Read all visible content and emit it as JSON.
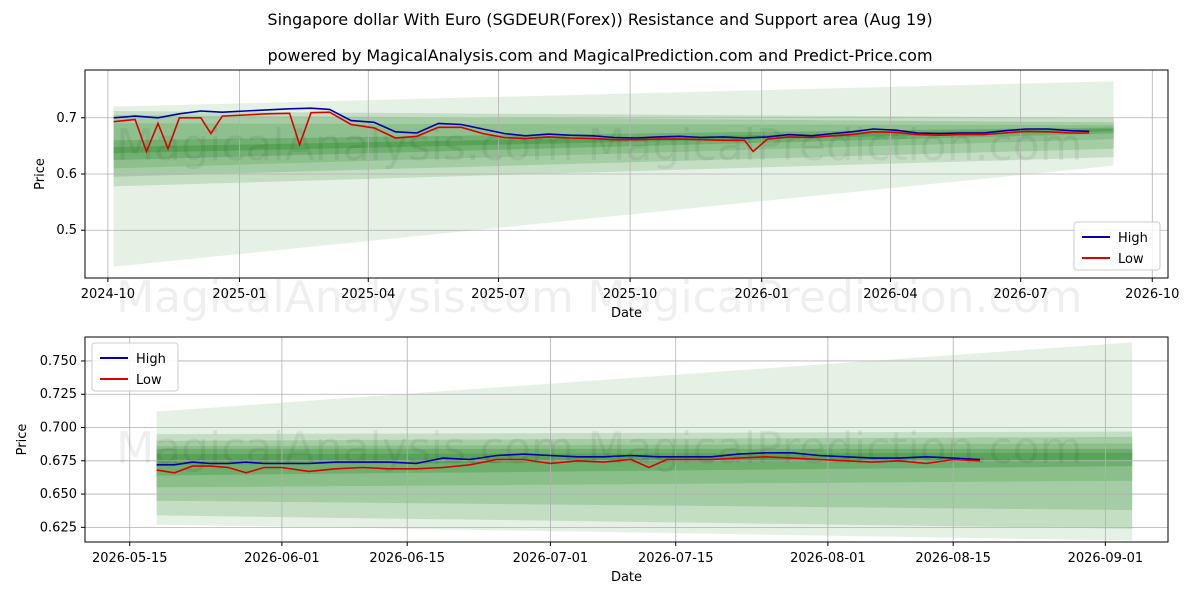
{
  "title": "Singapore dollar With Euro (SGDEUR(Forex)) Resistance and Support area (Aug 19)",
  "subtitle": "powered by MagicalAnalysis.com and MagicalPrediction.com and Predict-Price.com",
  "watermarks": [
    "MagicalAnalysis.com",
    "MagicalPrediction.com"
  ],
  "colors": {
    "high": "#0000aa",
    "low": "#dd0000",
    "band": "#2e8b2e",
    "grid": "#b0b0b0"
  },
  "chart_data": [
    {
      "type": "line",
      "title": "",
      "xlabel": "Date",
      "ylabel": "Price",
      "xlim": [
        "2024-09-15",
        "2026-10-12"
      ],
      "ylim": [
        0.415,
        0.785
      ],
      "xticks": [
        "2024-10",
        "2025-01",
        "2025-04",
        "2025-07",
        "2025-10",
        "2026-01",
        "2026-04",
        "2026-07",
        "2026-10"
      ],
      "xtick_dates": [
        "2024-10-01",
        "2025-01-01",
        "2025-04-01",
        "2025-07-01",
        "2025-10-01",
        "2026-01-01",
        "2026-04-01",
        "2026-07-01",
        "2026-10-01"
      ],
      "yticks": [
        0.5,
        0.6,
        0.7
      ],
      "grid": true,
      "legend": "lower-right",
      "series": [
        {
          "name": "High",
          "x": [
            "2024-10-05",
            "2024-10-20",
            "2024-11-05",
            "2024-11-20",
            "2024-12-05",
            "2024-12-20",
            "2025-01-05",
            "2025-01-20",
            "2025-02-05",
            "2025-02-20",
            "2025-03-05",
            "2025-03-20",
            "2025-04-05",
            "2025-04-20",
            "2025-05-05",
            "2025-05-20",
            "2025-06-05",
            "2025-06-20",
            "2025-07-05",
            "2025-07-20",
            "2025-08-05",
            "2025-08-20",
            "2025-09-05",
            "2025-09-20",
            "2025-10-05",
            "2025-10-20",
            "2025-11-05",
            "2025-11-20",
            "2025-12-05",
            "2025-12-20",
            "2026-01-05",
            "2026-01-20",
            "2026-02-05",
            "2026-02-20",
            "2026-03-05",
            "2026-03-20",
            "2026-04-05",
            "2026-04-20",
            "2026-05-05",
            "2026-05-20",
            "2026-06-05",
            "2026-06-20",
            "2026-07-05",
            "2026-07-20",
            "2026-08-05",
            "2026-08-18"
          ],
          "values": [
            0.7,
            0.703,
            0.7,
            0.707,
            0.712,
            0.71,
            0.712,
            0.714,
            0.716,
            0.717,
            0.715,
            0.695,
            0.692,
            0.675,
            0.673,
            0.69,
            0.688,
            0.68,
            0.672,
            0.668,
            0.671,
            0.669,
            0.668,
            0.665,
            0.664,
            0.666,
            0.667,
            0.665,
            0.666,
            0.664,
            0.666,
            0.67,
            0.668,
            0.672,
            0.675,
            0.68,
            0.678,
            0.673,
            0.672,
            0.673,
            0.673,
            0.677,
            0.68,
            0.68,
            0.677,
            0.676
          ]
        },
        {
          "name": "Low",
          "x": [
            "2024-10-05",
            "2024-10-20",
            "2024-10-28",
            "2024-11-05",
            "2024-11-12",
            "2024-11-20",
            "2024-12-05",
            "2024-12-12",
            "2024-12-20",
            "2025-01-05",
            "2025-01-20",
            "2025-02-05",
            "2025-02-12",
            "2025-02-20",
            "2025-03-05",
            "2025-03-20",
            "2025-04-05",
            "2025-04-20",
            "2025-05-05",
            "2025-05-20",
            "2025-06-05",
            "2025-06-20",
            "2025-07-05",
            "2025-07-20",
            "2025-08-05",
            "2025-08-20",
            "2025-09-05",
            "2025-09-20",
            "2025-10-05",
            "2025-10-20",
            "2025-11-05",
            "2025-11-20",
            "2025-12-05",
            "2025-12-20",
            "2025-12-26",
            "2026-01-05",
            "2026-01-20",
            "2026-02-05",
            "2026-02-20",
            "2026-03-05",
            "2026-03-20",
            "2026-04-05",
            "2026-04-20",
            "2026-05-05",
            "2026-05-20",
            "2026-06-05",
            "2026-06-20",
            "2026-07-05",
            "2026-07-20",
            "2026-08-05",
            "2026-08-18"
          ],
          "values": [
            0.693,
            0.697,
            0.64,
            0.69,
            0.645,
            0.7,
            0.7,
            0.672,
            0.703,
            0.705,
            0.707,
            0.708,
            0.652,
            0.709,
            0.71,
            0.688,
            0.682,
            0.664,
            0.667,
            0.683,
            0.683,
            0.672,
            0.665,
            0.663,
            0.666,
            0.664,
            0.663,
            0.661,
            0.661,
            0.662,
            0.662,
            0.661,
            0.66,
            0.66,
            0.64,
            0.662,
            0.666,
            0.665,
            0.668,
            0.67,
            0.675,
            0.674,
            0.67,
            0.669,
            0.67,
            0.67,
            0.673,
            0.676,
            0.675,
            0.673,
            0.673
          ]
        }
      ],
      "bands": [
        {
          "x": [
            "2024-10-05",
            "2026-09-04"
          ],
          "upper": [
            0.72,
            0.765
          ],
          "lower": [
            0.435,
            0.615
          ],
          "opacity": 0.12
        },
        {
          "x": [
            "2024-10-05",
            "2026-09-04"
          ],
          "upper": [
            0.712,
            0.7
          ],
          "lower": [
            0.578,
            0.63
          ],
          "opacity": 0.18
        },
        {
          "x": [
            "2024-10-05",
            "2026-09-04"
          ],
          "upper": [
            0.705,
            0.692
          ],
          "lower": [
            0.595,
            0.645
          ],
          "opacity": 0.2
        },
        {
          "x": [
            "2024-10-05",
            "2026-09-04"
          ],
          "upper": [
            0.69,
            0.687
          ],
          "lower": [
            0.61,
            0.662
          ],
          "opacity": 0.2
        },
        {
          "x": [
            "2024-10-05",
            "2026-09-04"
          ],
          "upper": [
            0.66,
            0.683
          ],
          "lower": [
            0.625,
            0.672
          ],
          "opacity": 0.3
        },
        {
          "x": [
            "2024-10-05",
            "2026-09-04"
          ],
          "upper": [
            0.648,
            0.681
          ],
          "lower": [
            0.637,
            0.676
          ],
          "opacity": 0.35
        }
      ]
    },
    {
      "type": "line",
      "title": "",
      "xlabel": "Date",
      "ylabel": "Price",
      "xlim": [
        "2026-05-10",
        "2026-09-08"
      ],
      "ylim": [
        0.614,
        0.768
      ],
      "xticks": [
        "2026-05-15",
        "2026-06-01",
        "2026-06-15",
        "2026-07-01",
        "2026-07-15",
        "2026-08-01",
        "2026-08-15",
        "2026-09-01"
      ],
      "xtick_dates": [
        "2026-05-15",
        "2026-06-01",
        "2026-06-15",
        "2026-07-01",
        "2026-07-15",
        "2026-08-01",
        "2026-08-15",
        "2026-09-01"
      ],
      "yticks": [
        0.625,
        0.65,
        0.675,
        0.7,
        0.725,
        0.75
      ],
      "grid": true,
      "legend": "top-left",
      "series": [
        {
          "name": "High",
          "x": [
            "2026-05-18",
            "2026-05-20",
            "2026-05-22",
            "2026-05-24",
            "2026-05-26",
            "2026-05-28",
            "2026-05-30",
            "2026-06-01",
            "2026-06-04",
            "2026-06-07",
            "2026-06-10",
            "2026-06-13",
            "2026-06-16",
            "2026-06-19",
            "2026-06-22",
            "2026-06-25",
            "2026-06-28",
            "2026-07-01",
            "2026-07-04",
            "2026-07-07",
            "2026-07-10",
            "2026-07-13",
            "2026-07-16",
            "2026-07-19",
            "2026-07-22",
            "2026-07-25",
            "2026-07-28",
            "2026-07-31",
            "2026-08-03",
            "2026-08-06",
            "2026-08-09",
            "2026-08-12",
            "2026-08-15",
            "2026-08-18"
          ],
          "values": [
            0.672,
            0.672,
            0.674,
            0.673,
            0.673,
            0.674,
            0.673,
            0.673,
            0.673,
            0.674,
            0.674,
            0.674,
            0.673,
            0.677,
            0.676,
            0.679,
            0.68,
            0.679,
            0.678,
            0.678,
            0.679,
            0.678,
            0.678,
            0.678,
            0.68,
            0.681,
            0.681,
            0.679,
            0.678,
            0.677,
            0.677,
            0.678,
            0.677,
            0.676
          ]
        },
        {
          "name": "Low",
          "x": [
            "2026-05-18",
            "2026-05-20",
            "2026-05-22",
            "2026-05-24",
            "2026-05-26",
            "2026-05-28",
            "2026-05-30",
            "2026-06-01",
            "2026-06-04",
            "2026-06-07",
            "2026-06-10",
            "2026-06-13",
            "2026-06-16",
            "2026-06-19",
            "2026-06-22",
            "2026-06-25",
            "2026-06-28",
            "2026-07-01",
            "2026-07-04",
            "2026-07-07",
            "2026-07-10",
            "2026-07-12",
            "2026-07-14",
            "2026-07-16",
            "2026-07-19",
            "2026-07-22",
            "2026-07-25",
            "2026-07-28",
            "2026-07-31",
            "2026-08-03",
            "2026-08-06",
            "2026-08-09",
            "2026-08-12",
            "2026-08-15",
            "2026-08-18"
          ],
          "values": [
            0.668,
            0.666,
            0.671,
            0.671,
            0.67,
            0.666,
            0.67,
            0.67,
            0.667,
            0.669,
            0.67,
            0.669,
            0.669,
            0.67,
            0.672,
            0.676,
            0.676,
            0.673,
            0.675,
            0.674,
            0.676,
            0.67,
            0.676,
            0.676,
            0.676,
            0.677,
            0.678,
            0.677,
            0.676,
            0.675,
            0.674,
            0.675,
            0.673,
            0.676,
            0.675
          ]
        }
      ],
      "bands": [
        {
          "x": [
            "2026-05-18",
            "2026-09-04"
          ],
          "upper": [
            0.712,
            0.764
          ],
          "lower": [
            0.627,
            0.615
          ],
          "opacity": 0.12
        },
        {
          "x": [
            "2026-05-18",
            "2026-09-04"
          ],
          "upper": [
            0.695,
            0.697
          ],
          "lower": [
            0.634,
            0.624
          ],
          "opacity": 0.18
        },
        {
          "x": [
            "2026-05-18",
            "2026-09-04"
          ],
          "upper": [
            0.69,
            0.693
          ],
          "lower": [
            0.645,
            0.638
          ],
          "opacity": 0.2
        },
        {
          "x": [
            "2026-05-18",
            "2026-09-04"
          ],
          "upper": [
            0.686,
            0.688
          ],
          "lower": [
            0.655,
            0.66
          ],
          "opacity": 0.22
        },
        {
          "x": [
            "2026-05-18",
            "2026-09-04"
          ],
          "upper": [
            0.684,
            0.684
          ],
          "lower": [
            0.664,
            0.671
          ],
          "opacity": 0.3
        },
        {
          "x": [
            "2026-05-18",
            "2026-09-04"
          ],
          "upper": [
            0.68,
            0.681
          ],
          "lower": [
            0.672,
            0.676
          ],
          "opacity": 0.35
        }
      ]
    }
  ]
}
